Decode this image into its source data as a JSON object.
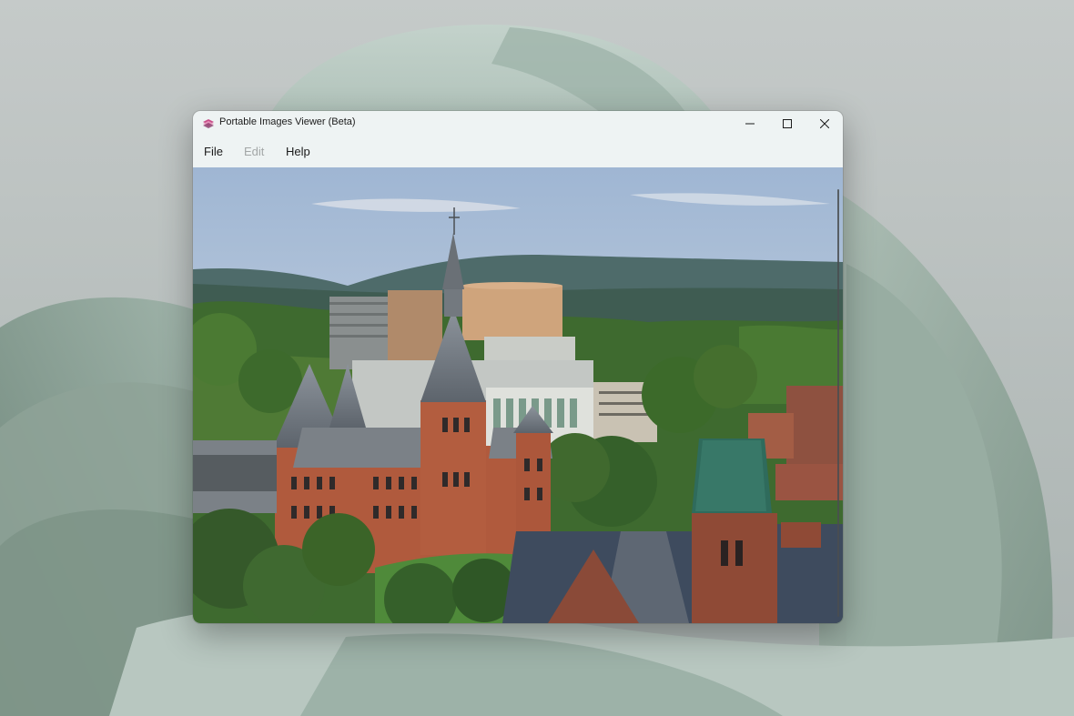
{
  "window": {
    "title": "Portable Images Viewer (Beta)",
    "icon": "app-logo-icon"
  },
  "caption_buttons": {
    "minimize_icon": "minimize-icon",
    "maximize_icon": "maximize-icon",
    "close_icon": "close-icon"
  },
  "menu": {
    "file": "File",
    "edit": "Edit",
    "help": "Help",
    "edit_disabled": true
  },
  "viewer": {
    "image_subject": "campus-photo",
    "scrollbar": "vertical"
  },
  "colors": {
    "window_bg": "#eef3f3",
    "text": "#1b1b1b",
    "disabled_text": "#a3a7a7"
  }
}
